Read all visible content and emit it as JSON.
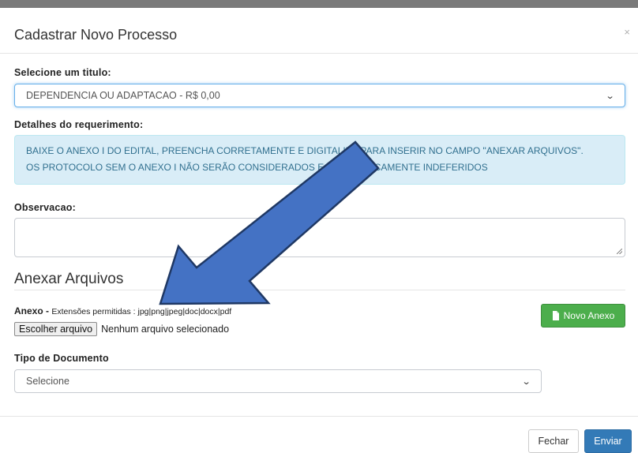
{
  "modal": {
    "title": "Cadastrar Novo Processo",
    "close_symbol": "×"
  },
  "form": {
    "titulo_label": "Selecione um titulo:",
    "titulo_selected": "DEPENDENCIA OU ADAPTACAO - R$ 0,00",
    "detalhes_label": "Detalhes do requerimento:",
    "detalhes_line1": "BAIXE O ANEXO I DO EDITAL, PREENCHA CORRETAMENTE E DIGITALIZE PARA INSERIR NO CAMPO \"ANEXAR ARQUIVOS\".",
    "detalhes_line2": "OS PROTOCOLO SEM O ANEXO I NÃO SERÃO CONSIDERADOS E AUTOMATICAMENTE INDEFERIDOS",
    "observacao_label": "Observacao:",
    "observacao_value": ""
  },
  "anexos": {
    "section_title": "Anexar Arquivos",
    "anexo_label": "Anexo -",
    "extensions": "Extensões permitidas : jpg|png|jpeg|doc|docx|pdf",
    "file_button": "Escolher arquivo",
    "file_status": "Nenhum arquivo selecionado",
    "novo_anexo_button": "Novo Anexo",
    "tipo_label": "Tipo de Documento",
    "tipo_selected": "Selecione"
  },
  "footer": {
    "fechar": "Fechar",
    "enviar": "Enviar"
  },
  "icons": {
    "close": "close-icon",
    "caret": "chevron-down-icon",
    "doc": "file-add-icon",
    "overlay": "arrow-annotation"
  },
  "colors": {
    "info_bg": "#d9edf7",
    "info_text": "#31708f",
    "success": "#4cae4c",
    "primary": "#337ab7",
    "arrow_fill": "#4472c4",
    "arrow_stroke": "#1f3864"
  }
}
